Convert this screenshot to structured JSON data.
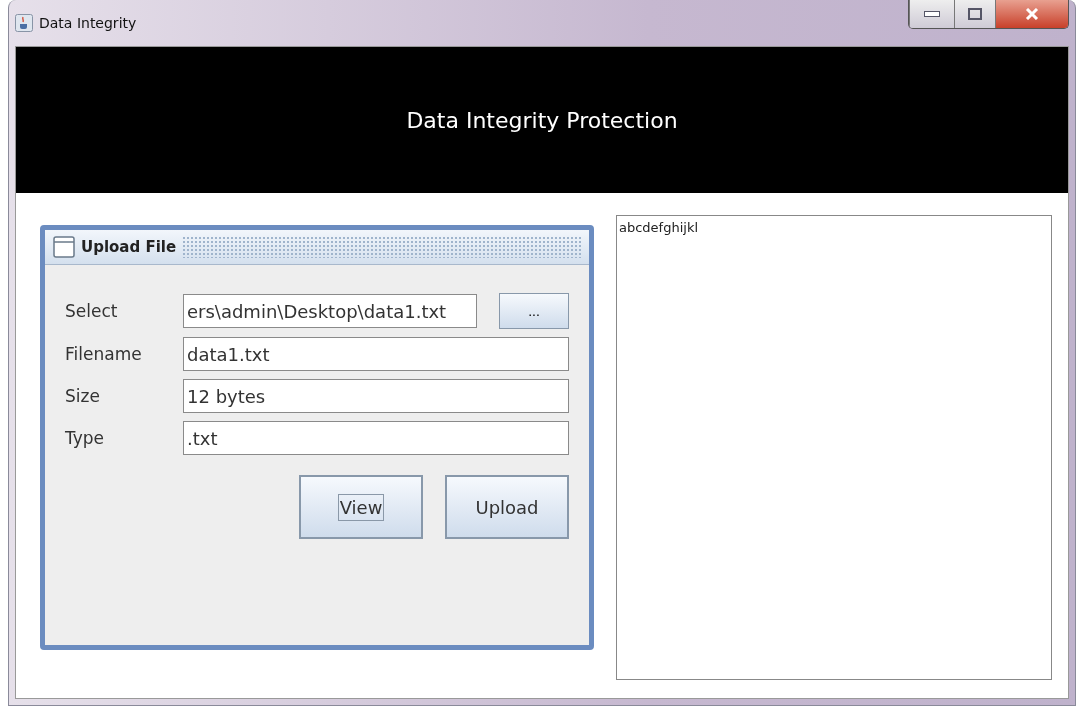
{
  "window": {
    "title": "Data Integrity"
  },
  "banner": {
    "title": "Data Integrity Protection"
  },
  "upload_panel": {
    "title": "Upload File",
    "fields": [
      {
        "label": "Select",
        "value": "ers\\admin\\Desktop\\data1.txt",
        "browse": "..."
      },
      {
        "label": "Filename",
        "value": "data1.txt"
      },
      {
        "label": "Size",
        "value": "12 bytes"
      },
      {
        "label": "Type",
        "value": ".txt"
      }
    ],
    "buttons": [
      {
        "label": "View",
        "focused": true
      },
      {
        "label": "Upload",
        "focused": false
      }
    ]
  },
  "content_area": {
    "text": "abcdefghijkl"
  }
}
